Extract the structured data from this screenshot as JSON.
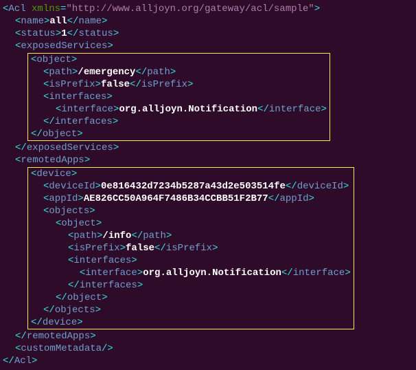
{
  "acl": {
    "xmlns": "\"http://www.alljoyn.org/gateway/acl/sample\"",
    "name": "all",
    "status": "1",
    "exposedServices": {
      "object": {
        "path": "/emergency",
        "isPrefix": "false",
        "interface": "org.alljoyn.Notification"
      }
    },
    "remotedApps": {
      "device": {
        "deviceId": "0e816432d7234b5287a43d2e503514fe",
        "appId": "AE826CC50A964F7486B34CCBB51F2B77",
        "object": {
          "path": "/info",
          "isPrefix": "false",
          "interface": "org.alljoyn.Notification"
        }
      }
    }
  }
}
